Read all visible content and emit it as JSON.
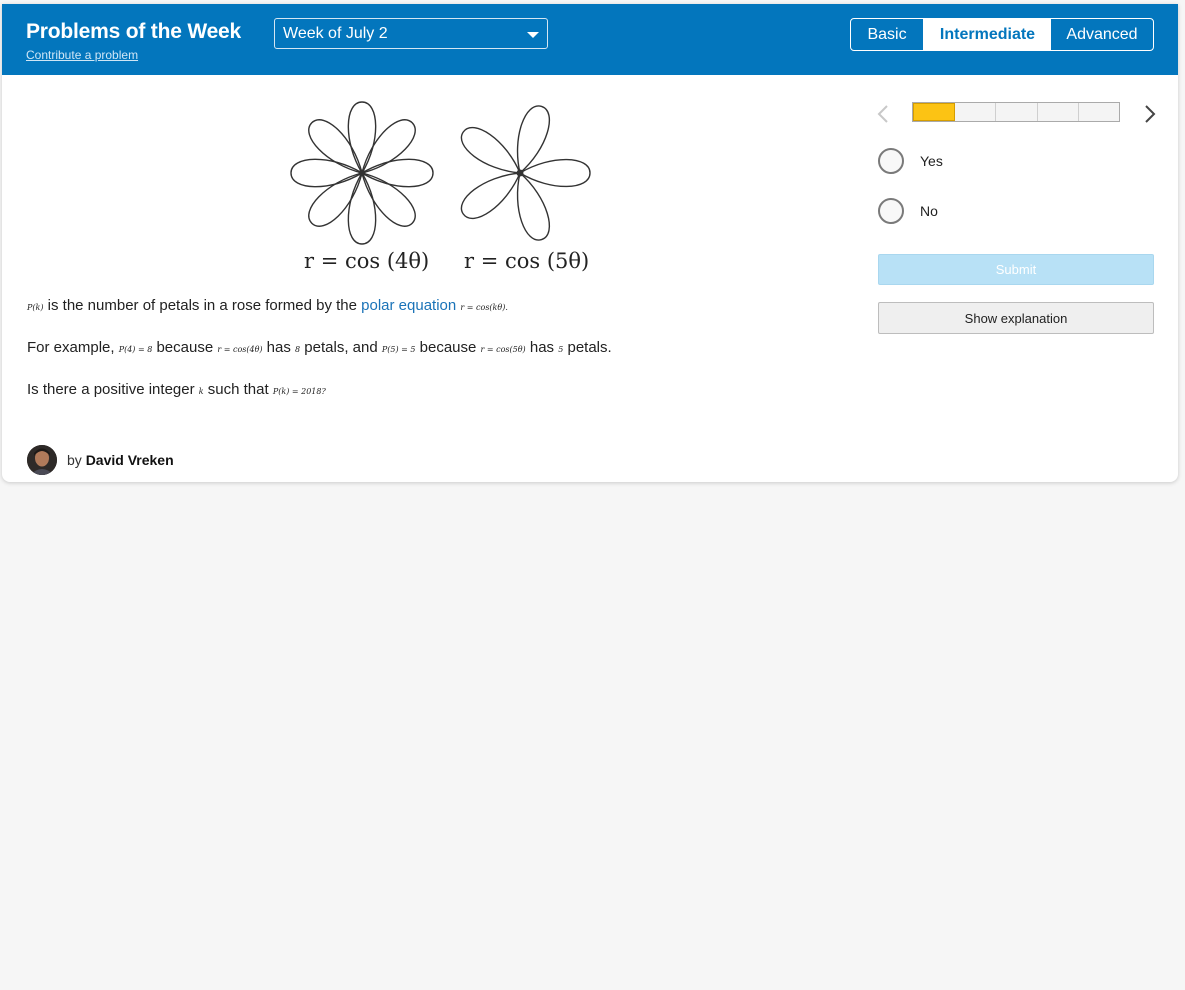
{
  "header": {
    "title": "Problems of the Week",
    "contribute_link": "Contribute a problem",
    "week_select": {
      "value": "Week of July 2"
    },
    "levels": [
      {
        "label": "Basic",
        "selected": false
      },
      {
        "label": "Intermediate",
        "selected": true
      },
      {
        "label": "Advanced",
        "selected": false
      }
    ]
  },
  "figure": {
    "caption_left": "r = cos (4θ)",
    "caption_right": "r = cos (5θ)"
  },
  "problem": {
    "line1": {
      "math_start": "P(k)",
      "text_a": " is the number of petals in a rose formed by the ",
      "link": "polar equation",
      "math_end": "r = cos(kθ)."
    },
    "line2": {
      "text_a": "For example, ",
      "math_1": "P(4) = 8",
      "text_b": " because ",
      "math_2": "r = cos(4θ)",
      "text_c": " has ",
      "math_3": "8",
      "text_d": " petals, and ",
      "math_4": "P(5) = 5",
      "text_e": " because ",
      "math_5": "r = cos(5θ)",
      "text_f": " has ",
      "math_6": "5",
      "text_g": " petals."
    },
    "line3": {
      "text_a": "Is there a positive integer ",
      "math_1": "k",
      "text_b": " such that ",
      "math_2": "P(k) = 2018?"
    }
  },
  "author": {
    "by": "by",
    "name": "David Vreken"
  },
  "sidebar": {
    "progress": {
      "segments": 5,
      "current": 1
    },
    "options": [
      {
        "label": "Yes"
      },
      {
        "label": "No"
      }
    ],
    "submit_label": "Submit",
    "explanation_label": "Show explanation"
  },
  "colors": {
    "header_bg": "#0376bd",
    "progress_active": "#fcc314",
    "submit_disabled": "#b8e1f6",
    "link": "#1a73b8"
  }
}
